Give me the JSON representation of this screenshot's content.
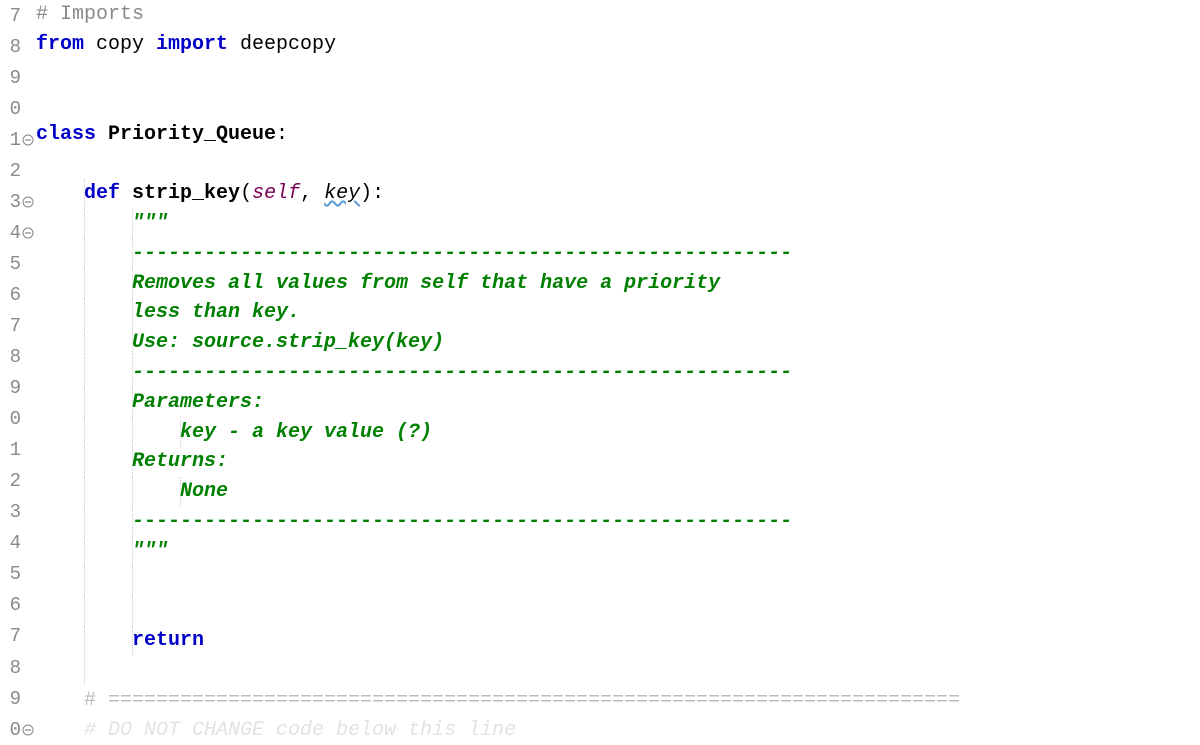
{
  "lines": [
    {
      "num": "7",
      "fold": null
    },
    {
      "num": "8",
      "fold": null
    },
    {
      "num": "9",
      "fold": null
    },
    {
      "num": "0",
      "fold": null
    },
    {
      "num": "1",
      "fold": "minus"
    },
    {
      "num": "2",
      "fold": null
    },
    {
      "num": "3",
      "fold": "minus"
    },
    {
      "num": "4",
      "fold": "minus"
    },
    {
      "num": "5",
      "fold": null
    },
    {
      "num": "6",
      "fold": null
    },
    {
      "num": "7",
      "fold": null
    },
    {
      "num": "8",
      "fold": null
    },
    {
      "num": "9",
      "fold": null
    },
    {
      "num": "0",
      "fold": null
    },
    {
      "num": "1",
      "fold": null
    },
    {
      "num": "2",
      "fold": null
    },
    {
      "num": "3",
      "fold": null
    },
    {
      "num": "4",
      "fold": null
    },
    {
      "num": "5",
      "fold": null
    },
    {
      "num": "6",
      "fold": null
    },
    {
      "num": "7",
      "fold": null
    },
    {
      "num": "8",
      "fold": null
    },
    {
      "num": "9",
      "fold": null
    },
    {
      "num": "0",
      "fold": "minus"
    }
  ],
  "code": {
    "l1_comment": "# Imports",
    "l2_from": "from",
    "l2_mod": " copy ",
    "l2_import": "import",
    "l2_name": " deepcopy",
    "l5_class": "class",
    "l5_name": " Priority_Queue",
    "l5_colon": ":",
    "l7_def": "def",
    "l7_name": " strip_key",
    "l7_open": "(",
    "l7_self": "self",
    "l7_comma": ", ",
    "l7_key": "key",
    "l7_close": "):",
    "l8_doc": "\"\"\"",
    "l9_doc": "-------------------------------------------------------",
    "l10_doc": "Removes all values from self that have a priority",
    "l11_doc": "less than key.",
    "l12_doc": "Use: source.strip_key(key)",
    "l13_doc": "-------------------------------------------------------",
    "l14_doc": "Parameters:",
    "l15_doc": "    key - a key value (?)",
    "l16_doc": "Returns:",
    "l17_doc": "    None",
    "l18_doc": "-------------------------------------------------------",
    "l19_doc": "\"\"\"",
    "l22_return": "return",
    "l24_comment": "# =======================================================================",
    "l25_comment": "# DO NOT CHANGE code below this line"
  },
  "indent1": "    ",
  "indent2": "        "
}
